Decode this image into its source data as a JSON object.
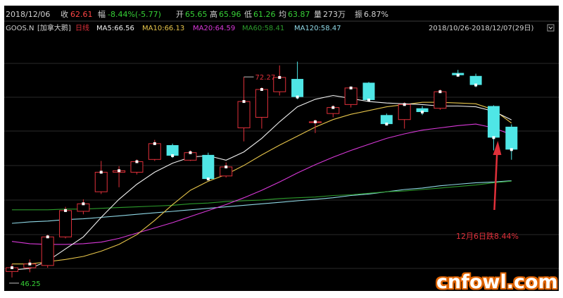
{
  "header": {
    "date": "2018/12/06",
    "close_label": "收",
    "close": "62.61",
    "change_label": "幅",
    "change": "-8.44%(-5.77)",
    "open_label": "开",
    "open": "65.65",
    "high_label": "高",
    "high": "65.96",
    "low_label": "低",
    "low": "61.26",
    "avg_label": "均",
    "avg": "63.87",
    "volume_label": "量",
    "volume": "273万",
    "amplitude_label": "振",
    "amplitude": "6.87%"
  },
  "legend": {
    "symbol": "GOOS.N",
    "name": "[加拿大鹅]",
    "period": "日线",
    "ma5": "MA5:66.56",
    "ma10": "MA10:66.13",
    "ma20": "MA20:64.59",
    "ma60": "MA60:58.41",
    "ma120": "MA120:58.47",
    "range": "2018/10/26-2018/12/07(29日)",
    "range_dropdown_icon": "chevron-down-icon"
  },
  "colors": {
    "up": "#e0303a",
    "down": "#4fe6e6",
    "ma5": "#f0f0f0",
    "ma10": "#e6c44a",
    "ma20": "#d838d8",
    "ma60": "#2c9b2c",
    "ma120": "#8fd8e6",
    "annotation": "#e0303a",
    "grid": "#2a2a2a"
  },
  "chart_data": {
    "type": "candlestick",
    "ylim": [
      44,
      78
    ],
    "grid": true,
    "candles": [
      {
        "o": 46.4,
        "c": 46.9,
        "h": 47.4,
        "l": 45.6
      },
      {
        "o": 46.9,
        "c": 47.4,
        "h": 48.0,
        "l": 46.3
      },
      {
        "o": 47.2,
        "c": 51.0,
        "h": 51.3,
        "l": 46.9
      },
      {
        "o": 51.0,
        "c": 54.5,
        "h": 55.0,
        "l": 50.8
      },
      {
        "o": 54.4,
        "c": 55.4,
        "h": 56.0,
        "l": 54.0
      },
      {
        "o": 57.0,
        "c": 59.6,
        "h": 61.1,
        "l": 56.7
      },
      {
        "o": 59.6,
        "c": 59.8,
        "h": 60.4,
        "l": 57.6
      },
      {
        "o": 59.6,
        "c": 61.0,
        "h": 61.3,
        "l": 59.3
      },
      {
        "o": 61.3,
        "c": 63.4,
        "h": 63.9,
        "l": 61.1
      },
      {
        "o": 63.2,
        "c": 61.8,
        "h": 63.4,
        "l": 61.5
      },
      {
        "o": 61.2,
        "c": 62.2,
        "h": 62.5,
        "l": 61.1
      },
      {
        "o": 61.9,
        "c": 58.7,
        "h": 62.2,
        "l": 58.6
      },
      {
        "o": 59.1,
        "c": 60.3,
        "h": 60.9,
        "l": 58.9
      },
      {
        "o": 65.5,
        "c": 69.0,
        "h": 72.27,
        "l": 63.7
      },
      {
        "o": 66.9,
        "c": 70.6,
        "h": 70.9,
        "l": 65.4
      },
      {
        "o": 70.3,
        "c": 72.2,
        "h": 73.8,
        "l": 69.8
      },
      {
        "o": 72.0,
        "c": 69.6,
        "h": 74.3,
        "l": 69.3
      },
      {
        "o": 66.2,
        "c": 66.3,
        "h": 66.6,
        "l": 64.8
      },
      {
        "o": 67.4,
        "c": 68.2,
        "h": 68.5,
        "l": 66.9
      },
      {
        "o": 68.6,
        "c": 70.8,
        "h": 71.0,
        "l": 68.2
      },
      {
        "o": 71.5,
        "c": 69.2,
        "h": 71.6,
        "l": 69.1
      },
      {
        "o": 67.2,
        "c": 66.0,
        "h": 67.4,
        "l": 65.8
      },
      {
        "o": 66.6,
        "c": 68.6,
        "h": 68.9,
        "l": 65.4
      },
      {
        "o": 68.1,
        "c": 67.6,
        "h": 68.4,
        "l": 67.2
      },
      {
        "o": 68.1,
        "c": 70.3,
        "h": 70.6,
        "l": 67.9
      },
      {
        "o": 72.8,
        "c": 72.5,
        "h": 73.2,
        "l": 72.3
      },
      {
        "o": 72.4,
        "c": 71.2,
        "h": 72.7,
        "l": 70.9
      },
      {
        "o": 68.4,
        "c": 64.2,
        "h": 68.5,
        "l": 62.5
      },
      {
        "o": 65.65,
        "c": 62.61,
        "h": 65.96,
        "l": 61.26
      }
    ],
    "ma5": [
      46.6,
      46.8,
      47.8,
      49.4,
      51.0,
      53.6,
      56.0,
      58.0,
      59.6,
      60.8,
      61.6,
      61.8,
      61.2,
      62.3,
      64.1,
      66.3,
      68.3,
      69.3,
      69.8,
      69.4,
      69.0,
      68.8,
      68.7,
      68.6,
      68.4,
      68.4,
      68.3,
      67.7,
      66.56
    ],
    "ma10": [
      47.4,
      47.4,
      47.7,
      48.0,
      48.4,
      49.1,
      50.0,
      51.3,
      53.2,
      55.3,
      57.2,
      58.4,
      59.3,
      60.5,
      61.9,
      63.2,
      64.4,
      65.6,
      66.6,
      67.3,
      67.8,
      68.3,
      68.6,
      68.9,
      68.9,
      68.8,
      68.7,
      67.9,
      66.13
    ],
    "ma20": [
      50.4,
      50.1,
      50.0,
      50.0,
      50.1,
      50.3,
      50.8,
      51.5,
      52.2,
      52.9,
      53.7,
      54.5,
      55.3,
      56.2,
      57.2,
      58.3,
      59.5,
      60.6,
      61.6,
      62.5,
      63.3,
      64.1,
      64.7,
      65.2,
      65.5,
      65.8,
      66.0,
      65.5,
      64.59
    ],
    "ma60": [
      54.6,
      54.6,
      54.6,
      54.7,
      54.7,
      54.8,
      54.9,
      55.0,
      55.1,
      55.2,
      55.4,
      55.5,
      55.7,
      55.8,
      55.9,
      56.1,
      56.2,
      56.3,
      56.5,
      56.6,
      56.8,
      57.0,
      57.1,
      57.3,
      57.5,
      57.7,
      57.9,
      58.2,
      58.41
    ],
    "ma120": [
      52.8,
      53.0,
      53.1,
      53.3,
      53.4,
      53.6,
      53.8,
      54.0,
      54.2,
      54.4,
      54.6,
      54.8,
      55.0,
      55.2,
      55.4,
      55.6,
      55.8,
      56.0,
      56.2,
      56.5,
      56.7,
      57.0,
      57.3,
      57.5,
      57.8,
      58.0,
      58.2,
      58.3,
      58.47
    ],
    "max_label": "72.27",
    "min_label": "46.25",
    "annotation": "12月6日跌8.44%"
  },
  "watermark": "cnfowl.com"
}
